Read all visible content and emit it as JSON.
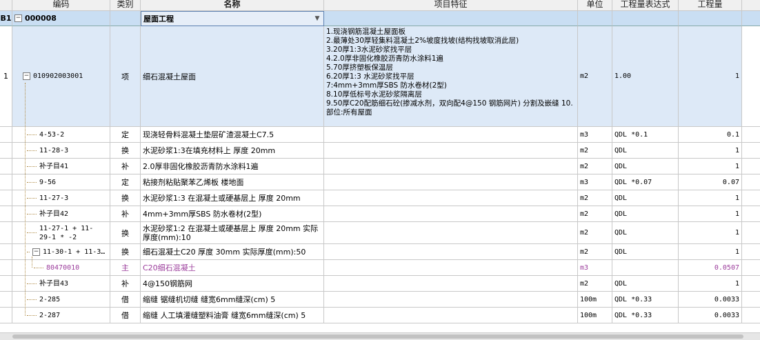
{
  "headers": {
    "code": "编码",
    "category": "类别",
    "name": "名称",
    "features": "项目特征",
    "unit": "单位",
    "expr": "工程量表达式",
    "qty": "工程量"
  },
  "section": {
    "label": "B1",
    "code": "000008",
    "name": "屋面工程"
  },
  "item": {
    "rownum": "1",
    "code": "010902003001",
    "category": "项",
    "name": "细石混凝土屋面",
    "features": [
      "1.现浇钢筋混凝土屋面板",
      "2.最薄处30厚轻集料混凝土2%坡度找坡(结构找坡取消此层)",
      "3.20厚1:3水泥砂浆找平层",
      "4.2.0厚非固化橡胶沥青防水涂料1遍",
      "5.70厚挤塑板保温层",
      "6.20厚1:3 水泥砂浆找平层",
      "7:4mm+3mm厚SBS 防水卷材(2型)",
      "8.10厚低标号水泥砂浆隔离层",
      "9.50厚C20配筋细石砼(掺减水剂，双向配4@150 钢筋网片) 分割及嵌缝        10.部位:所有屋面"
    ],
    "unit": "m2",
    "expr": "1.00",
    "qty": "1"
  },
  "rows": [
    {
      "code": "4-53-2",
      "category": "定",
      "name": "现浇轻骨料混凝土垫层矿渣混凝土C7.5",
      "unit": "m3",
      "expr": "QDL *0.1",
      "qty": "0.1"
    },
    {
      "code": "11-28-3",
      "category": "换",
      "name": "水泥砂浆1:3在填充材料上 厚度 20mm",
      "unit": "m2",
      "expr": "QDL",
      "qty": "1"
    },
    {
      "code": "补子目41",
      "category": "补",
      "name": "2.0厚非固化橡胶沥青防水涂料1遍",
      "unit": "m2",
      "expr": "QDL",
      "qty": "1"
    },
    {
      "code": "9-56",
      "category": "定",
      "name": "粘接剂粘贴聚苯乙烯板 楼地面",
      "unit": "m3",
      "expr": "QDL *0.07",
      "qty": "0.07"
    },
    {
      "code": "11-27-3",
      "category": "换",
      "name": "水泥砂浆1:3 在混凝土或硬基层上 厚度 20mm",
      "unit": "m2",
      "expr": "QDL",
      "qty": "1"
    },
    {
      "code": "补子目42",
      "category": "补",
      "name": "4mm+3mm厚SBS 防水卷材(2型)",
      "unit": "m2",
      "expr": "QDL",
      "qty": "1"
    },
    {
      "code": "11-27-1 + 11-29-1 * -2",
      "category": "换",
      "name": "水泥砂浆1:2 在混凝土或硬基层上 厚度 20mm 实际厚度(mm):10",
      "unit": "m2",
      "expr": "QDL",
      "qty": "1"
    },
    {
      "code": "11-30-1 + 11-3…",
      "category": "换",
      "name": "细石混凝土C20 厚度 30mm  实际厚度(mm):50",
      "unit": "m2",
      "expr": "QDL",
      "qty": "1"
    },
    {
      "code": "80470010",
      "category": "主",
      "name": "C20细石混凝土",
      "unit": "m3",
      "expr": "",
      "qty": "0.0507"
    },
    {
      "code": "补子目43",
      "category": "补",
      "name": "4@150钢筋网",
      "unit": "m2",
      "expr": "QDL",
      "qty": "1"
    },
    {
      "code": "2-285",
      "category": "借",
      "name": "缩缝 锯缝机切缝 缝宽6mm缝深(cm) 5",
      "unit": "100m",
      "expr": "QDL *0.33",
      "qty": "0.0033"
    },
    {
      "code": "2-287",
      "category": "借",
      "name": "缩缝 人工填灌缝塑料油膏 缝宽6mm缝深(cm) 5",
      "unit": "100m",
      "expr": "QDL *0.33",
      "qty": "0.0033"
    }
  ],
  "colors": {
    "section_bg": "#c9def3",
    "item_bg": "#dde9f7",
    "main_material": "#9b3c9b"
  }
}
